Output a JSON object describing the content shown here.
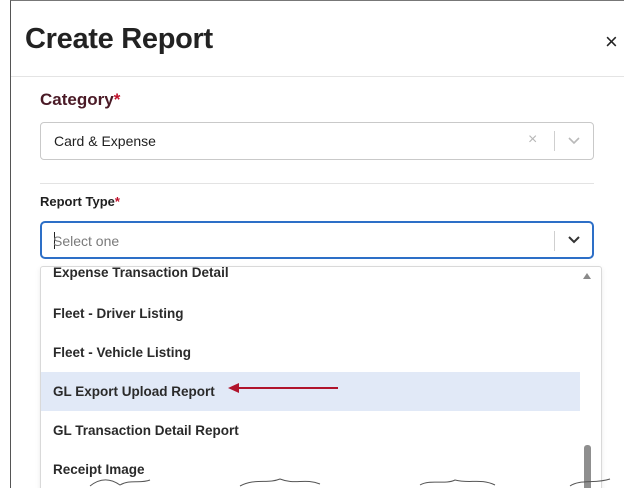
{
  "modal": {
    "title": "Create Report",
    "close_label": "×"
  },
  "category": {
    "label": "Category",
    "required_mark": "*",
    "value": "Card & Expense",
    "clear_icon": "×"
  },
  "report_type": {
    "label": "Report Type",
    "required_mark": "*",
    "placeholder": "Select one"
  },
  "dropdown": {
    "options": [
      "Expense Transaction Detail",
      "Fleet - Driver Listing",
      "Fleet - Vehicle Listing",
      "GL Export Upload Report",
      "GL Transaction Detail Report",
      "Receipt Image"
    ],
    "highlighted_index": 3
  },
  "colors": {
    "focus_border": "#2d6fc7",
    "highlight_bg": "#e1e9f7",
    "label_dark": "#4a1a26",
    "required": "#c0102a",
    "annotation_arrow": "#b0142c"
  },
  "icons": {
    "close": "close-icon",
    "clear": "clear-icon",
    "dropdown": "chevron-down-icon",
    "scroll_up": "scroll-up-icon"
  }
}
